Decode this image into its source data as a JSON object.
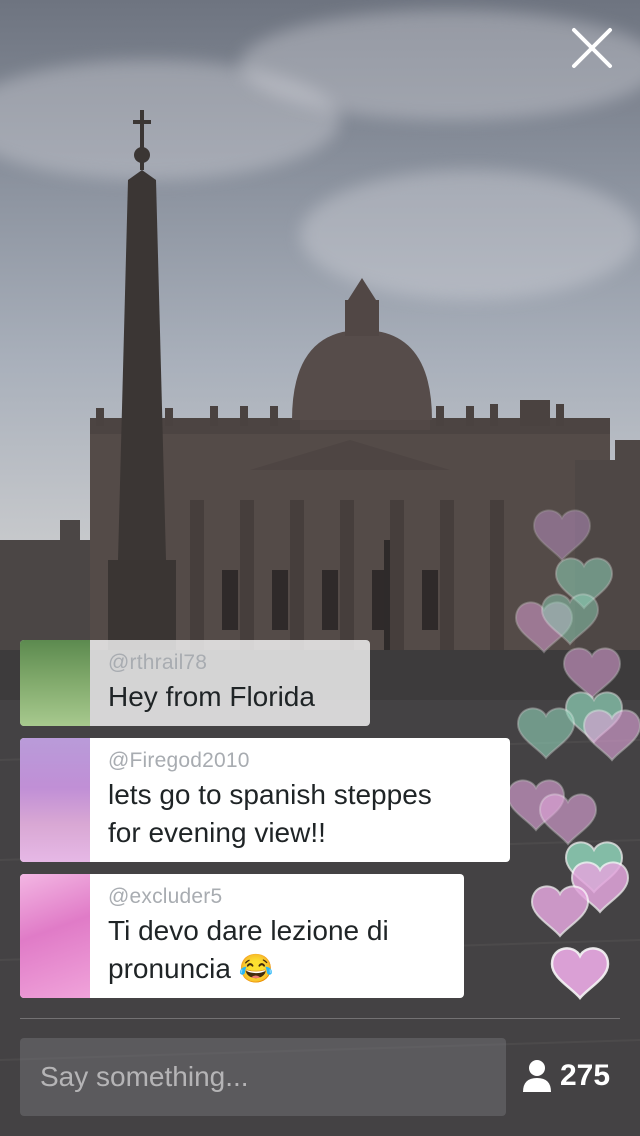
{
  "comments": [
    {
      "username": "@rthrail78",
      "text": "Hey from Florida",
      "avatar_color_top": "#5c8a4f",
      "avatar_color_bottom": "#a7c98e"
    },
    {
      "username": "@Firegod2010",
      "text_line1": "lets go to spanish steppes",
      "text_line2": "for evening view!!",
      "avatar_color_top": "#c08fd6",
      "avatar_color_bottom": "#e6b8e6"
    },
    {
      "username": "@excluder5",
      "text_line1": "Ti devo dare lezione di",
      "text_line2": "pronuncia",
      "emoji": "😂",
      "avatar_color_top": "#e07bc7",
      "avatar_color_bottom": "#f3b6e3"
    }
  ],
  "input": {
    "placeholder": "Say something..."
  },
  "viewers": {
    "count": "275"
  },
  "icons": {
    "close": "close-icon",
    "viewer": "person-icon",
    "heart": "heart-icon"
  },
  "colors": {
    "heart_pink": "#e3a6dd",
    "heart_green": "#8fd2b8",
    "heart_purple": "#c99bd6"
  }
}
